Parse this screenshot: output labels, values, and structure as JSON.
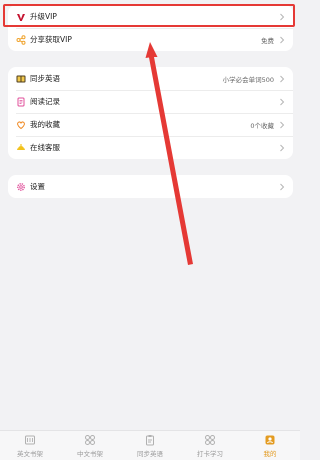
{
  "vip_card": {
    "upgrade_label": "升级VIP",
    "share_label": "分享获取VIP",
    "share_value": "免费"
  },
  "menu_card": {
    "items": [
      {
        "label": "同步英语",
        "value": "小学必会单词500"
      },
      {
        "label": "阅读记录",
        "value": ""
      },
      {
        "label": "我的收藏",
        "value": "0个收藏"
      },
      {
        "label": "在线客服",
        "value": ""
      }
    ]
  },
  "settings_card": {
    "settings_label": "设置"
  },
  "tabbar": {
    "tabs": [
      {
        "label": "英文书架"
      },
      {
        "label": "中文书架"
      },
      {
        "label": "同步英语"
      },
      {
        "label": "打卡学习"
      },
      {
        "label": "我的"
      }
    ]
  },
  "colors": {
    "accent": "#e39b21",
    "highlight_red": "#e53935",
    "vip_red": "#c4122f"
  }
}
